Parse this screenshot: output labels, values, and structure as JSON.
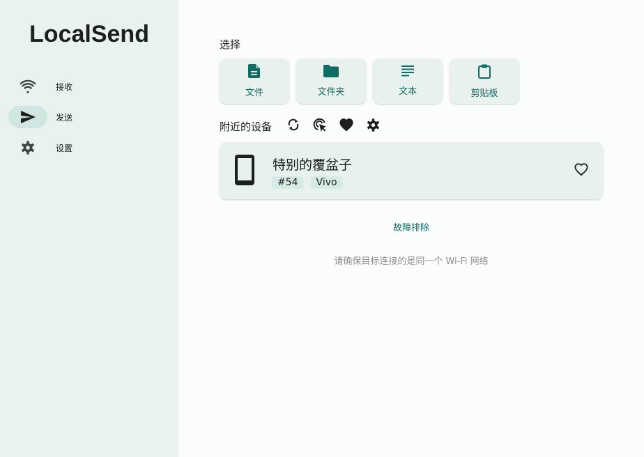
{
  "app": {
    "title": "LocalSend"
  },
  "sidebar": {
    "items": [
      {
        "label": "接收",
        "icon": "wifi-icon",
        "active": false
      },
      {
        "label": "发送",
        "icon": "send-icon",
        "active": true
      },
      {
        "label": "设置",
        "icon": "gear-icon",
        "active": false
      }
    ]
  },
  "selection": {
    "title": "选择",
    "buttons": [
      {
        "label": "文件",
        "icon": "file-icon"
      },
      {
        "label": "文件夹",
        "icon": "folder-icon"
      },
      {
        "label": "文本",
        "icon": "text-icon"
      },
      {
        "label": "剪贴板",
        "icon": "clipboard-icon"
      }
    ]
  },
  "nearby": {
    "title": "附近的设备",
    "actions": [
      "refresh-icon",
      "scan-cursor-icon",
      "heart-filled-icon",
      "gear-icon"
    ],
    "devices": [
      {
        "name": "特别的覆盆子",
        "tags": [
          "#54",
          "Vivo"
        ],
        "icon": "smartphone-icon",
        "favorite": false
      }
    ]
  },
  "troubleshoot_label": "故障排除",
  "hint": "请确保目标连接的是同一个 Wi-Fi 网络",
  "colors": {
    "sidebar_bg": "#eaf2ef",
    "accent": "#0f6d63",
    "active_pill": "#cfe7e0",
    "card_bg": "#e9f1ee",
    "hint_text": "#8c9290"
  }
}
